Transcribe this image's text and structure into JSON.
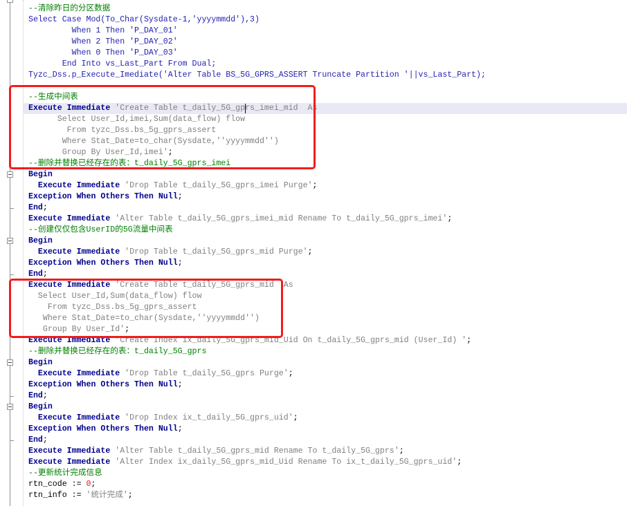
{
  "editor": {
    "colors": {
      "comment": "#008000",
      "keyword": "#00008c",
      "blue": "#1f1fb0",
      "string": "#808080",
      "plain": "#000000",
      "number": "#e01818",
      "annotation": "#f21c1c",
      "current_line": "#e9e9f5"
    },
    "lines": [
      {
        "partial": true,
        "gutter": "fold-open-icon",
        "tokens": []
      },
      {
        "tokens": [
          {
            "cm": "--清除昨日的分区数据"
          }
        ]
      },
      {
        "tokens": [
          {
            "bl": "Select Case Mod(To_Char(Sysdate-1,'yyyymmdd'),3)"
          }
        ]
      },
      {
        "tokens": [
          {
            "bl": "         When 1 Then 'P_DAY_01'"
          }
        ]
      },
      {
        "tokens": [
          {
            "bl": "         When 2 Then 'P_DAY_02'"
          }
        ]
      },
      {
        "tokens": [
          {
            "bl": "         When 0 Then 'P_DAY_03'"
          }
        ]
      },
      {
        "tokens": [
          {
            "bl": "       End Into vs_Last_Part From Dual;"
          }
        ]
      },
      {
        "tokens": [
          {
            "bl": "Tyzc_Dss.p_Execute_Imediate('Alter Table BS_5G_GPRS_ASSERT Truncate Partition '||vs_Last_Part);"
          }
        ]
      },
      {
        "tokens": []
      },
      {
        "tokens": [
          {
            "cm": "--生成中间表"
          }
        ]
      },
      {
        "current": true,
        "tokens": [
          {
            "kw": "Execute Immediate"
          },
          {
            "st": " 'Create Table t_daily_5G_gprs_imei_mid  As"
          }
        ]
      },
      {
        "tokens": [
          {
            "st": "      Select User_Id,imei,Sum(data_flow) flow"
          }
        ]
      },
      {
        "tokens": [
          {
            "st": "        From tyzc_Dss.bs_5g_gprs_assert"
          }
        ]
      },
      {
        "tokens": [
          {
            "st": "       Where Stat_Date=to_char(Sysdate,''yyyymmdd'')"
          }
        ]
      },
      {
        "tokens": [
          {
            "st": "       Group By User_Id,imei'"
          },
          {
            "pl": ";"
          }
        ]
      },
      {
        "tokens": [
          {
            "cm": "--删除并替换已经存在的表：t_daily_5G_gprs_imei"
          }
        ]
      },
      {
        "gutter": "fold-open-icon",
        "tokens": [
          {
            "kw": "Begin"
          }
        ]
      },
      {
        "tokens": [
          {
            "kw": "  Execute Immediate"
          },
          {
            "st": " 'Drop Table t_daily_5G_gprs_imei Purge'"
          },
          {
            "pl": ";"
          }
        ]
      },
      {
        "tokens": [
          {
            "kw": "Exception When Others Then Null"
          },
          {
            "pl": ";"
          }
        ]
      },
      {
        "gutter": "fold-end-icon",
        "tokens": [
          {
            "kw": "End"
          },
          {
            "pl": ";"
          }
        ]
      },
      {
        "tokens": [
          {
            "kw": "Execute Immediate"
          },
          {
            "st": " 'Alter Table t_daily_5G_gprs_imei_mid Rename To t_daily_5G_gprs_imei'"
          },
          {
            "pl": ";"
          }
        ]
      },
      {
        "tokens": [
          {
            "cm": "--创建仅仅包含UserID的5G流量中间表"
          }
        ]
      },
      {
        "gutter": "fold-open-icon",
        "tokens": [
          {
            "kw": "Begin"
          }
        ]
      },
      {
        "tokens": [
          {
            "kw": "  Execute Immediate"
          },
          {
            "st": " 'Drop Table t_daily_5G_gprs_mid Purge'"
          },
          {
            "pl": ";"
          }
        ]
      },
      {
        "tokens": [
          {
            "kw": "Exception When Others Then Null"
          },
          {
            "pl": ";"
          }
        ]
      },
      {
        "gutter": "fold-end-icon",
        "tokens": [
          {
            "kw": "End"
          },
          {
            "pl": ";"
          }
        ]
      },
      {
        "tokens": [
          {
            "kw": "Execute Immediate"
          },
          {
            "st": " 'Create Table t_daily_5G_gprs_mid  As"
          }
        ]
      },
      {
        "tokens": [
          {
            "st": "  Select User_Id,Sum(data_flow) flow"
          }
        ]
      },
      {
        "tokens": [
          {
            "st": "    From tyzc_Dss.bs_5g_gprs_assert"
          }
        ]
      },
      {
        "tokens": [
          {
            "st": "   Where Stat_Date=to_char(Sysdate,''yyyymmdd'')"
          }
        ]
      },
      {
        "tokens": [
          {
            "st": "   Group By User_Id'"
          },
          {
            "pl": ";"
          }
        ]
      },
      {
        "tokens": [
          {
            "kw": "Execute Immediate"
          },
          {
            "st": " 'Create Index ix_daily_5G_gprs_mid_Uid On t_daily_5G_gprs_mid (User_Id) '"
          },
          {
            "pl": ";"
          }
        ]
      },
      {
        "tokens": [
          {
            "cm": "--删除并替换已经存在的表：t_daily_5G_gprs"
          }
        ]
      },
      {
        "gutter": "fold-open-icon",
        "tokens": [
          {
            "kw": "Begin"
          }
        ]
      },
      {
        "tokens": [
          {
            "kw": "  Execute Immediate"
          },
          {
            "st": " 'Drop Table t_daily_5G_gprs Purge'"
          },
          {
            "pl": ";"
          }
        ]
      },
      {
        "tokens": [
          {
            "kw": "Exception When Others Then Null"
          },
          {
            "pl": ";"
          }
        ]
      },
      {
        "gutter": "fold-end-icon",
        "tokens": [
          {
            "kw": "End"
          },
          {
            "pl": ";"
          }
        ]
      },
      {
        "gutter": "fold-open-icon",
        "tokens": [
          {
            "kw": "Begin"
          }
        ]
      },
      {
        "tokens": [
          {
            "kw": "  Execute Immediate"
          },
          {
            "st": " 'Drop Index ix_t_daily_5G_gprs_uid'"
          },
          {
            "pl": ";"
          }
        ]
      },
      {
        "tokens": [
          {
            "kw": "Exception When Others Then Null"
          },
          {
            "pl": ";"
          }
        ]
      },
      {
        "gutter": "fold-end-icon",
        "tokens": [
          {
            "kw": "End"
          },
          {
            "pl": ";"
          }
        ]
      },
      {
        "tokens": [
          {
            "kw": "Execute Immediate"
          },
          {
            "st": " 'Alter Table t_daily_5G_gprs_mid Rename To t_daily_5G_gprs'"
          },
          {
            "pl": ";"
          }
        ]
      },
      {
        "tokens": [
          {
            "kw": "Execute Immediate"
          },
          {
            "st": " 'Alter Index ix_daily_5G_gprs_mid_Uid Rename To ix_t_daily_5G_gprs_uid'"
          },
          {
            "pl": ";"
          }
        ]
      },
      {
        "tokens": [
          {
            "cm": "--更新统计完成信息"
          }
        ]
      },
      {
        "tokens": [
          {
            "pl": "rtn_code := "
          },
          {
            "nu": "0"
          },
          {
            "pl": ";"
          }
        ]
      },
      {
        "tokens": [
          {
            "pl": "rtn_info := "
          },
          {
            "st": "'统计完成'"
          },
          {
            "pl": ";"
          }
        ]
      }
    ]
  }
}
